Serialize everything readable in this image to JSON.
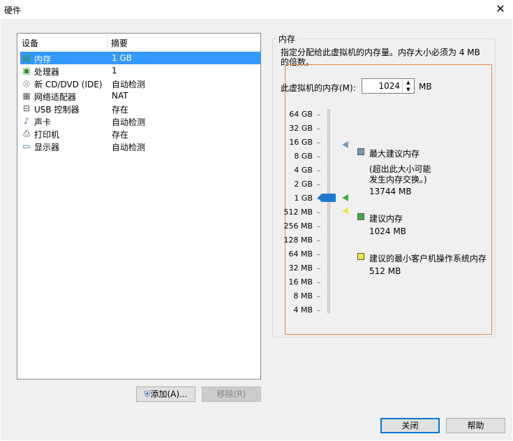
{
  "window": {
    "title": "硬件",
    "close_glyph": "✕"
  },
  "device_list": {
    "columns": [
      "设备",
      "摘要"
    ],
    "rows": [
      {
        "name": "内存",
        "summary": "1 GB",
        "icon": "memory-icon",
        "selected": true
      },
      {
        "name": "处理器",
        "summary": "1",
        "icon": "processor-icon"
      },
      {
        "name": "新 CD/DVD (IDE)",
        "summary": "自动检测",
        "icon": "cd-dvd-icon"
      },
      {
        "name": "网络适配器",
        "summary": "NAT",
        "icon": "network-adapter-icon"
      },
      {
        "name": "USB 控制器",
        "summary": "存在",
        "icon": "usb-icon"
      },
      {
        "name": "声卡",
        "summary": "自动检测",
        "icon": "sound-card-icon"
      },
      {
        "name": "打印机",
        "summary": "存在",
        "icon": "printer-icon"
      },
      {
        "name": "显示器",
        "summary": "自动检测",
        "icon": "display-icon"
      }
    ]
  },
  "buttons": {
    "add": "添加(A)...",
    "remove": "移除(R)",
    "close": "关闭",
    "help": "帮助"
  },
  "memory": {
    "group_title": "内存",
    "description": "指定分配给此虚拟机的内存量。内存大小必须为 4 MB 的倍数。",
    "field_label": "此虚拟机的内存(M):",
    "value": "1024",
    "unit": "MB",
    "scale": [
      "64 GB",
      "32 GB",
      "16 GB",
      "8 GB",
      "4 GB",
      "2 GB",
      "1 GB",
      "512 MB",
      "256 MB",
      "128 MB",
      "64 MB",
      "32 MB",
      "16 MB",
      "8 MB",
      "4 MB"
    ],
    "legend": {
      "max": {
        "title": "最大建议内存",
        "note1": "(超出此大小可能",
        "note2": "发生内存交换。)",
        "value": "13744 MB",
        "color": "#7a98b8"
      },
      "recommended": {
        "title": "建议内存",
        "value": "1024 MB",
        "color": "#3cb043"
      },
      "min": {
        "title": "建议的最小客户机操作系统内存",
        "value": "512 MB",
        "color": "#e8e84a"
      }
    }
  }
}
